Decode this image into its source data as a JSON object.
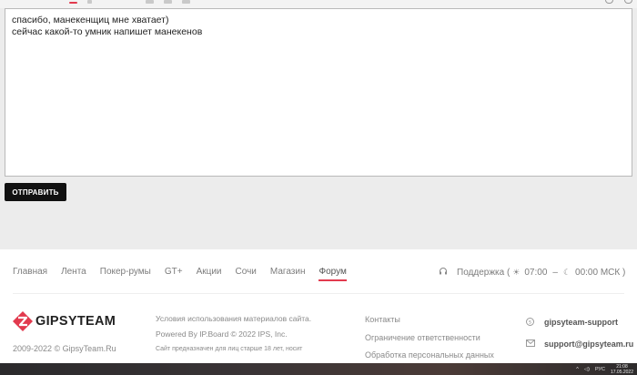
{
  "editor": {
    "lines": [
      "спасибо, манекенщиц мне хватает)",
      "сейчас какой-то умник напишет манекенов"
    ]
  },
  "send_button": {
    "label": "ОТПРАВИТЬ"
  },
  "footer": {
    "nav": [
      {
        "label": "Главная",
        "active": false
      },
      {
        "label": "Лента",
        "active": false
      },
      {
        "label": "Покер-румы",
        "active": false
      },
      {
        "label": "GT+",
        "active": false
      },
      {
        "label": "Акции",
        "active": false
      },
      {
        "label": "Сочи",
        "active": false
      },
      {
        "label": "Магазин",
        "active": false
      },
      {
        "label": "Форум",
        "active": true
      }
    ],
    "support": {
      "label": "Поддержка (",
      "start_time": "07:00",
      "dash": "–",
      "end_time": "00:00 МСК )",
      "icons": [
        "headset-icon",
        "sun-icon",
        "moon-icon"
      ]
    },
    "logo": {
      "text": "GIPSYTEAM",
      "color": "#e23a4e"
    },
    "copyright": "2009-2022 © GipsyTeam.Ru",
    "legal": {
      "terms": "Условия использования материалов сайта.",
      "powered": "Powered By IP.Board © 2022 IPS, Inc.",
      "age_notice": "Сайт предназначен для лиц старше 18 лет, носит"
    },
    "links": [
      "Контакты",
      "Ограничение ответственности",
      "Обработка персональных данных"
    ],
    "contacts": {
      "skype": "gipsyteam-support",
      "email": "support@gipsyteam.ru"
    }
  },
  "taskbar": {
    "lang": "РУС",
    "time": "21:08",
    "date": "17.05.2022"
  },
  "colors": {
    "accent": "#e23a4e",
    "button_bg": "#111111"
  }
}
